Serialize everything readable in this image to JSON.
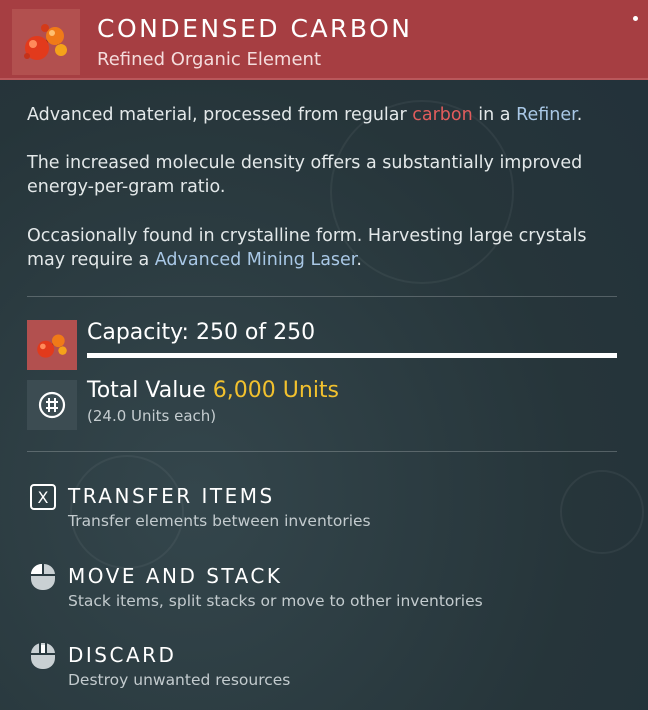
{
  "item": {
    "title": "CONDENSED CARBON",
    "subtitle": "Refined Organic Element",
    "icon": "carbon-molecule-icon",
    "header_color": "#a63e42"
  },
  "description": {
    "p1": {
      "before": "Advanced material, processed from regular ",
      "keyword1": "carbon",
      "middle": " in a ",
      "keyword2": "Refiner",
      "after": "."
    },
    "p2": "The increased molecule density offers a substantially improved energy-per-gram ratio.",
    "p3": {
      "before": "Occasionally found in crystalline form. Harvesting large crystals may require a ",
      "keyword": "Advanced Mining Laser",
      "after": "."
    }
  },
  "stats": {
    "capacity_label": "Capacity: 250 of 250",
    "capacity_current": 250,
    "capacity_max": 250,
    "value_label": "Total Value",
    "value_amount": "6,000 Units",
    "value_each": "(24.0 Units each)",
    "value_icon": "units-currency-icon"
  },
  "actions": [
    {
      "key": "X",
      "title": "TRANSFER ITEMS",
      "subtitle": "Transfer elements between inventories",
      "icon": "x-key-icon"
    },
    {
      "title": "MOVE AND STACK",
      "subtitle": "Stack items, split stacks or move to other inventories",
      "icon": "mouse-left-click-icon"
    },
    {
      "title": "DISCARD",
      "subtitle": "Destroy unwanted resources",
      "icon": "mouse-middle-click-icon"
    }
  ],
  "colors": {
    "keyword_red": "#e25c5c",
    "keyword_blue": "#a9c8e6",
    "value_gold": "#f2c12e"
  }
}
